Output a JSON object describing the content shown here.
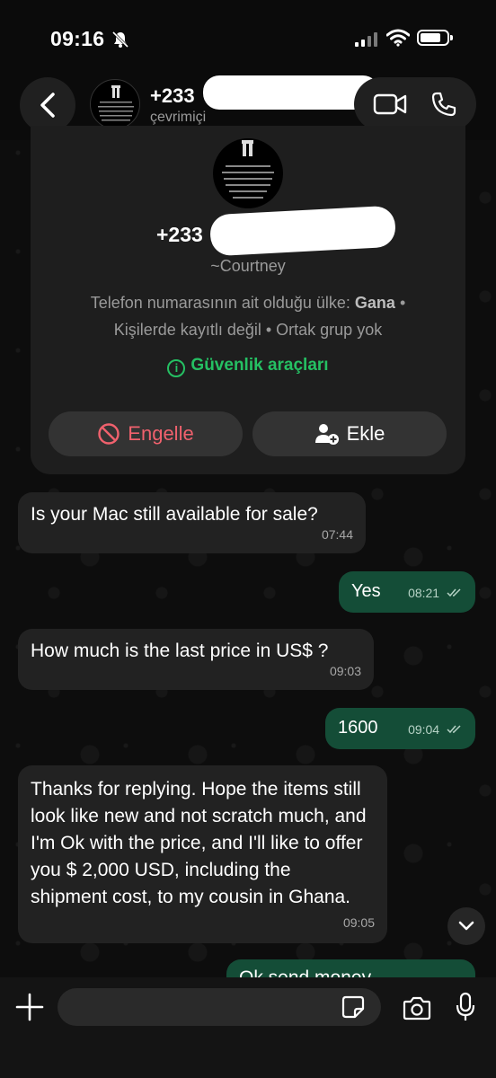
{
  "status_bar": {
    "time": "09:16"
  },
  "header": {
    "phone": "+233",
    "status": "çevrimiçi"
  },
  "contact_card": {
    "phone": "+233",
    "name": "~Courtney",
    "meta_line1_prefix": "Telefon numarasının ait olduğu ülke: ",
    "meta_country": "Gana",
    "meta_line1_suffix": " •",
    "meta_line2": "Kişilerde kayıtlı değil • Ortak grup yok",
    "security_label": "Güvenlik araçları",
    "block_label": "Engelle",
    "add_label": "Ekle"
  },
  "messages": [
    {
      "direction": "in",
      "text": "Is your Mac  still available for sale?",
      "time": "07:44"
    },
    {
      "direction": "out",
      "text": "Yes",
      "time": "08:21"
    },
    {
      "direction": "in",
      "text": "How much is the last price in US$ ?",
      "time": "09:03"
    },
    {
      "direction": "out",
      "text": "1600",
      "time": "09:04"
    },
    {
      "direction": "in",
      "text": "Thanks for replying. Hope the items still look like new and not scratch much, and I'm Ok with the price, and I'll like to offer you  $  2,000 USD, including the shipment cost, to my cousin in Ghana.",
      "time": "09:05"
    },
    {
      "direction": "out",
      "text": "Ok send money",
      "time": ""
    }
  ],
  "colors": {
    "accent_green": "#25c063",
    "outgoing_bubble": "#144d37",
    "incoming_bubble": "#222222",
    "block_red": "#f0616d"
  }
}
